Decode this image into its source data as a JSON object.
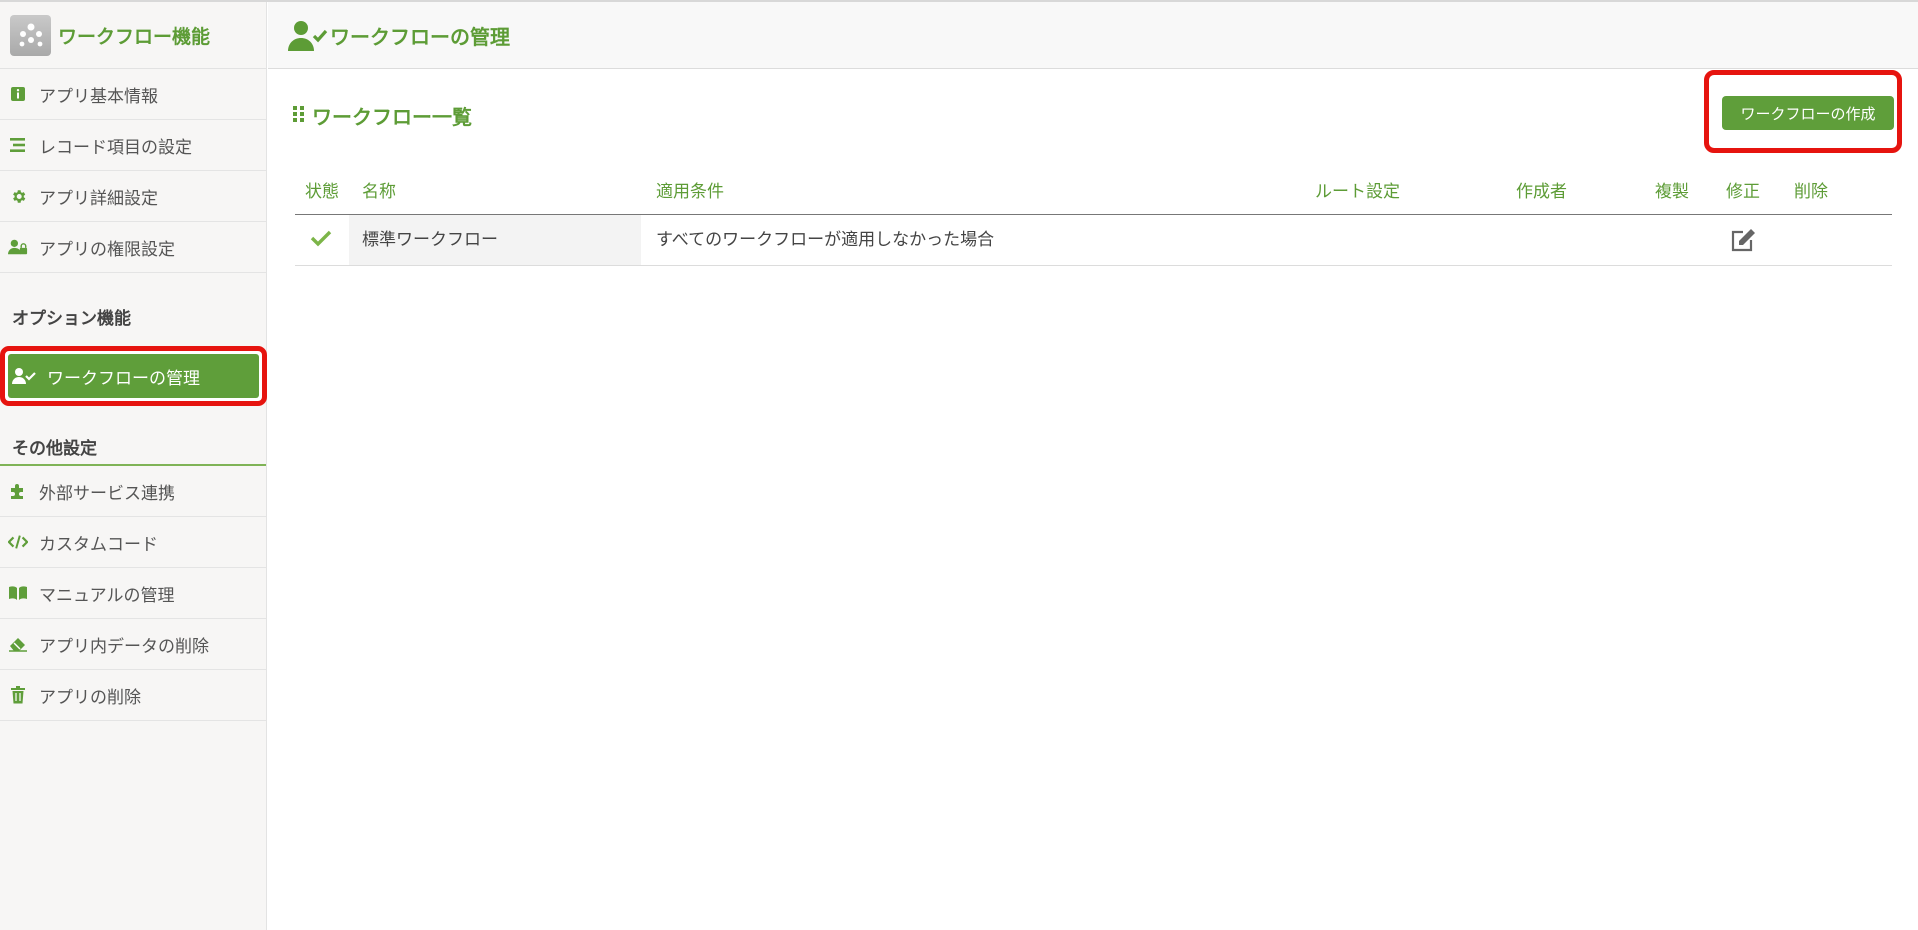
{
  "sidebar": {
    "title": "ワークフロー機能",
    "items": [
      {
        "label": "アプリ基本情報",
        "icon": "info-icon"
      },
      {
        "label": "レコード項目の設定",
        "icon": "list-icon"
      },
      {
        "label": "アプリ詳細設定",
        "icon": "gear-icon"
      },
      {
        "label": "アプリの権限設定",
        "icon": "user-lock-icon"
      }
    ],
    "option_section": "オプション機能",
    "active_item": {
      "label": "ワークフローの管理",
      "icon": "user-check-icon"
    },
    "other_section": "その他設定",
    "other_items": [
      {
        "label": "外部サービス連携",
        "icon": "puzzle-icon"
      },
      {
        "label": "カスタムコード",
        "icon": "code-icon"
      },
      {
        "label": "マニュアルの管理",
        "icon": "book-icon"
      },
      {
        "label": "アプリ内データの削除",
        "icon": "eraser-icon"
      },
      {
        "label": "アプリの削除",
        "icon": "trash-icon"
      }
    ]
  },
  "header": {
    "title": "ワークフローの管理",
    "icon": "user-check-icon"
  },
  "main": {
    "list_title": "ワークフロー一覧",
    "create_button": "ワークフローの作成",
    "columns": [
      "状態",
      "名称",
      "適用条件",
      "ルート設定",
      "作成者",
      "複製",
      "修正",
      "削除"
    ],
    "rows": [
      {
        "status": "check-icon",
        "name": "標準ワークフロー",
        "condition": "すべてのワークフローが適用しなかった場合",
        "route": "",
        "creator": "",
        "edit": "edit-icon"
      }
    ]
  },
  "colors": {
    "accent": "#5f9e3a",
    "highlight": "#e6140f"
  }
}
